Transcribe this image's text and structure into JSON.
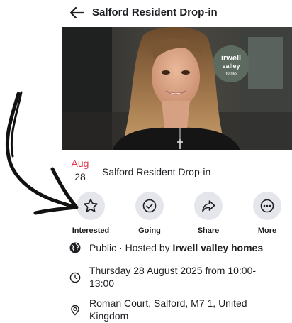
{
  "header": {
    "title": "Salford Resident Drop-in",
    "back_icon": "arrow-left-icon"
  },
  "cover": {
    "signage_line1": "irwell",
    "signage_line2": "valley",
    "signage_line3": "homes"
  },
  "event": {
    "month": "Aug",
    "day": "28",
    "title": "Salford Resident Drop-in"
  },
  "actions": [
    {
      "label": "Interested",
      "icon": "star-icon"
    },
    {
      "label": "Going",
      "icon": "check-circle-icon"
    },
    {
      "label": "Share",
      "icon": "share-arrow-icon"
    },
    {
      "label": "More",
      "icon": "more-dots-icon"
    }
  ],
  "details": {
    "privacy_prefix": "Public · Hosted by ",
    "host": "Irwell valley homes",
    "datetime": "Thursday 28 August 2025 from 10:00-13:00",
    "location": "Roman Court, Salford, M7 1, United Kingdom"
  },
  "colors": {
    "accent_date": "#e4344d",
    "button_bg": "#e4e6eb",
    "text": "#1c1e21"
  }
}
